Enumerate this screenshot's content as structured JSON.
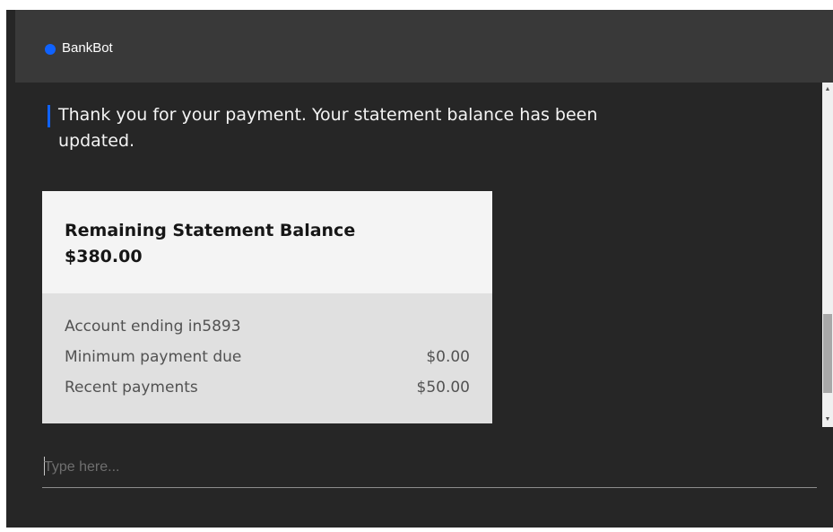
{
  "header": {
    "bot_name": "BankBot",
    "status_color": "#0f62fe",
    "status_icon": "status-dot-icon"
  },
  "message": {
    "text": "Thank you for your payment. Your statement balance has been updated."
  },
  "card": {
    "title": "Remaining Statement Balance",
    "amount": "$380.00",
    "rows": [
      {
        "label": "Account ending in5893",
        "value": ""
      },
      {
        "label": "Minimum payment due",
        "value": "$0.00"
      },
      {
        "label": "Recent payments",
        "value": "$50.00"
      }
    ]
  },
  "scrollbar": {
    "up_icon": "arrow-up-icon",
    "down_icon": "arrow-down-icon"
  },
  "input": {
    "placeholder": "Type here..."
  }
}
